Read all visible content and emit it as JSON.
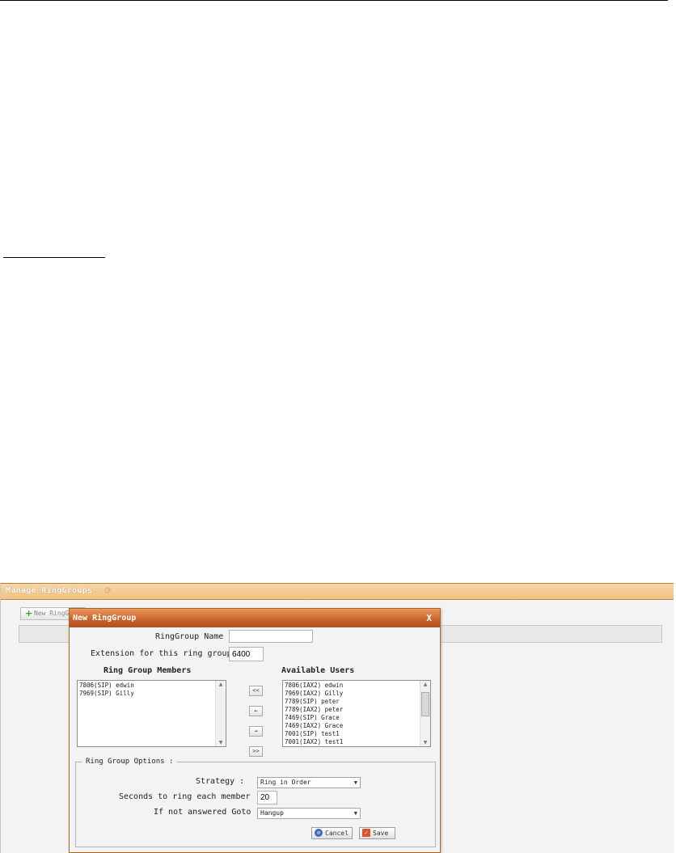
{
  "manage": {
    "title": "Manage RingGroups",
    "refresh_icon": "refresh-icon",
    "new_button_label": "New RingG"
  },
  "dialog": {
    "title": "New RingGroup",
    "close_label": "X",
    "name_label": "RingGroup Name :",
    "name_value": "",
    "extension_label": "Extension for this ring group :",
    "extension_value": "6400",
    "members_heading": "Ring Group Members",
    "available_heading": "Available Users",
    "members": [
      "7806(SIP) edwin",
      "7969(SIP) Gilly"
    ],
    "available": [
      "7806(IAX2) edwin",
      "7969(IAX2) Gilly",
      "7789(SIP) peter",
      "7789(IAX2) peter",
      "7469(SIP) Grace",
      "7469(IAX2) Grace",
      "7001(SIP) test1",
      "7001(IAX2) test1"
    ],
    "move_buttons": [
      "<<",
      "←",
      "→",
      ">>"
    ],
    "options_legend": "Ring Group Options :",
    "strategy_label": "Strategy :",
    "strategy_value": "Ring in Order",
    "seconds_label": "Seconds to ring each member :",
    "seconds_value": "20",
    "goto_label": "If not answered Goto :",
    "goto_value": "Hangup",
    "cancel_label": "Cancel",
    "save_label": "Save"
  },
  "colors": {
    "header_orange": "#c8612a",
    "manage_header": "#f0c184",
    "cancel_icon": "#3b6bc4",
    "save_icon": "#d9532c"
  }
}
